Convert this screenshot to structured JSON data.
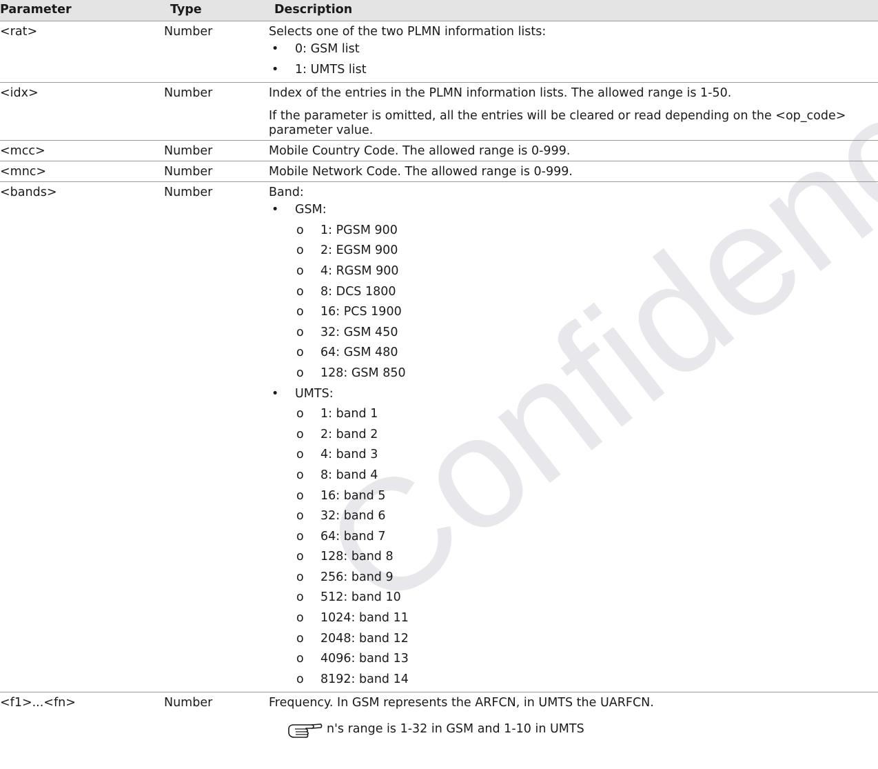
{
  "watermark": "Confidence Information",
  "headers": {
    "parameter": "Parameter",
    "type": "Type",
    "description": "Description"
  },
  "rows": {
    "rat": {
      "param": "<rat>",
      "type": "Number",
      "desc": "Selects one of the two PLMN information lists:",
      "items": [
        "0: GSM list",
        "1: UMTS list"
      ]
    },
    "idx": {
      "param": "<idx>",
      "type": "Number",
      "desc": "Index of the entries in the PLMN information lists. The allowed range is 1-50.",
      "desc2": "If the parameter is omitted, all the entries will be cleared or read depending on the <op_code> parameter value."
    },
    "mcc": {
      "param": "<mcc>",
      "type": "Number",
      "desc": "Mobile Country Code. The allowed range is 0-999."
    },
    "mnc": {
      "param": "<mnc>",
      "type": "Number",
      "desc": "Mobile Network Code. The allowed range is 0-999."
    },
    "bands": {
      "param": "<bands>",
      "type": "Number",
      "desc": "Band:",
      "gsm": {
        "label": "GSM:",
        "items": [
          "1: PGSM 900",
          "2: EGSM 900",
          "4: RGSM 900",
          "8: DCS 1800",
          "16: PCS 1900",
          "32: GSM 450",
          "64: GSM 480",
          "128: GSM 850"
        ]
      },
      "umts": {
        "label": "UMTS:",
        "items": [
          "1: band 1",
          "2: band 2",
          "4: band 3",
          "8: band 4",
          "16: band 5",
          "32: band 6",
          "64: band 7",
          "128: band 8",
          "256: band 9",
          "512: band 10",
          "1024: band 11",
          "2048: band 12",
          "4096: band 13",
          "8192: band 14"
        ]
      }
    },
    "freq": {
      "param": "<f1>...<fn>",
      "type": "Number",
      "desc": "Frequency. In GSM represents the ARFCN, in UMTS the UARFCN.",
      "note": "n's range is 1-32 in GSM and 1-10 in UMTS"
    }
  },
  "symbols": {
    "bullet": "•",
    "sub_bullet": "o"
  },
  "icons": {
    "note": "pointing-hand-icon"
  }
}
